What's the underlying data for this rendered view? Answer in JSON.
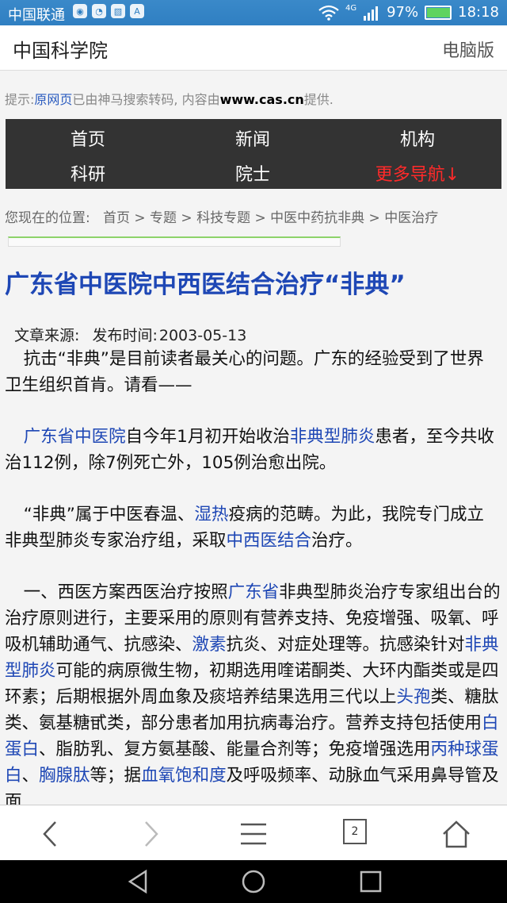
{
  "status_bar": {
    "carrier": "中国联通",
    "network": "4G",
    "battery": "97%",
    "time": "18:18"
  },
  "header": {
    "site_title": "中国科学院",
    "desktop_link": "电脑版"
  },
  "notice": {
    "prefix": "提示:",
    "original_link": "原网页",
    "middle": "已由神马搜索转码, 内容由",
    "domain": "www.cas.cn",
    "suffix": "提供."
  },
  "nav": {
    "items": [
      {
        "label": "首页"
      },
      {
        "label": "新闻"
      },
      {
        "label": "机构"
      },
      {
        "label": "科研"
      },
      {
        "label": "院士"
      },
      {
        "label": "更多导航↓"
      }
    ]
  },
  "breadcrumb": {
    "label": "您现在的位置:",
    "items": [
      "首页",
      "专题",
      "科技专题",
      "中医中药抗非典",
      "中医治疗"
    ],
    "sep": ">"
  },
  "article": {
    "title": "广东省中医院中西医结合治疗“非典”",
    "source_label": "文章来源:",
    "date_label": "发布时间:",
    "date": "2003-05-13",
    "p1": "抗击“非典”是目前读者最关心的问题。广东的经验受到了世界卫生组织首肯。请看——",
    "p2": {
      "link1": "广东省中医院",
      "t1": "自今年1月初开始收治",
      "link2": "非典型肺炎",
      "t2": "患者，至今共收治112例，除7例死亡外，105例治愈出院。"
    },
    "p3": {
      "t1": "“非典”属于中医春温、",
      "link1": "湿热",
      "t2": "疫病的范畴。为此，我院专门成立非典型肺炎专家治疗组，采取",
      "link2": "中西医结合",
      "t3": "治疗。"
    },
    "p4": {
      "t1": "一、西医方案西医治疗按照",
      "link1": "广东省",
      "t2": "非典型肺炎治疗专家组出台的治疗原则进行，主要采用的原则有营养支持、免疫增强、吸氧、呼吸机辅助通气、抗感染、",
      "link2": "激素",
      "t3": "抗炎、对症处理等。抗感染针对",
      "link3": "非典型肺炎",
      "t4": "可能的病原微生物，初期选用喹诺酮类、大环内酯类或是四环素；后期根据外周血象及痰培养结果选用三代以上",
      "link4": "头孢",
      "t5": "类、糖肽类、氨基糖甙类，部分患者加用抗病毒治疗。营养支持包括使用",
      "link5": "白蛋白",
      "t6": "、脂肪乳、复方氨基酸、能量合剂等；免疫增强选用",
      "link6": "丙种球蛋白",
      "t7": "、",
      "link7": "胸腺肽",
      "t8": "等；据",
      "link8": "血氧饱和度",
      "t9": "及呼吸频率、动脉血气采用鼻导管及面"
    }
  },
  "browser_bar": {
    "tab_count": "2"
  }
}
